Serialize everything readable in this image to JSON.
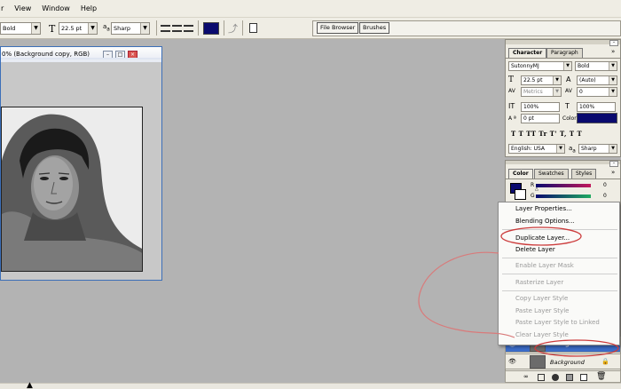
{
  "menu": {
    "items": [
      "r",
      "View",
      "Window",
      "Help"
    ]
  },
  "options_bar": {
    "font_style": "Bold",
    "font_size": "22.5 pt",
    "aa_prefix": "a",
    "aa_label": "a",
    "antialias": "Sharp",
    "text_color": "#0a0a6e",
    "file_browser": "File Browser",
    "brushes": "Brushes"
  },
  "document": {
    "title": "0% (Background copy, RGB)"
  },
  "character_panel": {
    "tabs": [
      "Character",
      "Paragraph"
    ],
    "font_family": "SutonnyMJ",
    "font_style": "Bold",
    "font_size": "22.5 pt",
    "leading": "(Auto)",
    "kerning": "Metrics",
    "tracking": "0",
    "vertical_scale": "100%",
    "horizontal_scale": "100%",
    "baseline_shift": "0 pt",
    "color_label": "Color:",
    "text_color": "#0a0a6e",
    "style_buttons": "T  T  TT Tr T' T,  T  T",
    "language": "English: USA",
    "aa_label": "a",
    "antialias": "Sharp"
  },
  "color_panel": {
    "tabs": [
      "Color",
      "Swatches",
      "Styles"
    ],
    "r_label": "R",
    "g_label": "G",
    "r_value": "0",
    "g_value": "0"
  },
  "context_menu": {
    "items": [
      {
        "label": "Layer Properties...",
        "enabled": true
      },
      {
        "label": "Blending Options...",
        "enabled": true
      },
      {
        "label": "Duplicate Layer...",
        "enabled": true
      },
      {
        "label": "Delete Layer",
        "enabled": true
      },
      {
        "label": "Enable Layer Mask",
        "enabled": false
      },
      {
        "label": "Rasterize Layer",
        "enabled": false
      },
      {
        "label": "Copy Layer Style",
        "enabled": false
      },
      {
        "label": "Paste Layer Style",
        "enabled": false
      },
      {
        "label": "Paste Layer Style to Linked",
        "enabled": false
      },
      {
        "label": "Clear Layer Style",
        "enabled": false
      }
    ]
  },
  "layers": {
    "rows": [
      {
        "name": "Background c...",
        "selected": true
      },
      {
        "name": "Background",
        "selected": false
      }
    ]
  },
  "colors": {
    "annotation_red": "#cc3c3c",
    "selection_blue": "#3366cc",
    "workspace_gray": "#b3b3b3"
  }
}
